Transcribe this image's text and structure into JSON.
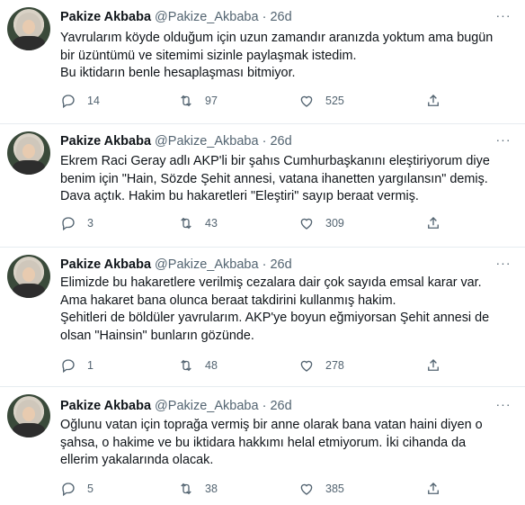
{
  "tweets": [
    {
      "name": "Pakize Akbaba",
      "handle": "@Pakize_Akbaba",
      "dot": "·",
      "time": "26d",
      "lines": [
        "Yavrularım köyde olduğum için uzun zamandır aranızda yoktum ama bugün",
        "bir üzüntümü ve sitemimi sizinle paylaşmak istedim.",
        "Bu iktidarın benle hesaplaşması bitmiyor."
      ],
      "replies": "14",
      "retweets": "97",
      "likes": "525"
    },
    {
      "name": "Pakize Akbaba",
      "handle": "@Pakize_Akbaba",
      "dot": "·",
      "time": "26d",
      "lines": [
        "Ekrem Raci Geray adlı AKP'li bir şahıs Cumhurbaşkanını eleştiriyorum diye",
        "benim için \"Hain, Sözde Şehit annesi, vatana ihanetten yargılansın\" demiş.",
        "Dava açtık. Hakim bu hakaretleri \"Eleştiri\" sayıp beraat vermiş."
      ],
      "replies": "3",
      "retweets": "43",
      "likes": "309"
    },
    {
      "name": "Pakize Akbaba",
      "handle": "@Pakize_Akbaba",
      "dot": "·",
      "time": "26d",
      "lines": [
        "Elimizde bu hakaretlere verilmiş cezalara dair çok sayıda emsal karar var.",
        "Ama hakaret bana olunca beraat takdirini kullanmış hakim.",
        "Şehitleri de böldüler yavrularım. AKP'ye boyun eğmiyorsan Şehit annesi de",
        "olsan \"Hainsin\" bunların gözünde."
      ],
      "replies": "1",
      "retweets": "48",
      "likes": "278"
    },
    {
      "name": "Pakize Akbaba",
      "handle": "@Pakize_Akbaba",
      "dot": "·",
      "time": "26d",
      "lines": [
        "Oğlunu vatan için toprağa vermiş bir anne olarak bana vatan haini diyen o",
        "şahsa, o hakime ve bu iktidara hakkımı helal etmiyorum. İki cihanda da",
        "ellerim yakalarında olacak."
      ],
      "replies": "5",
      "retweets": "38",
      "likes": "385"
    }
  ]
}
